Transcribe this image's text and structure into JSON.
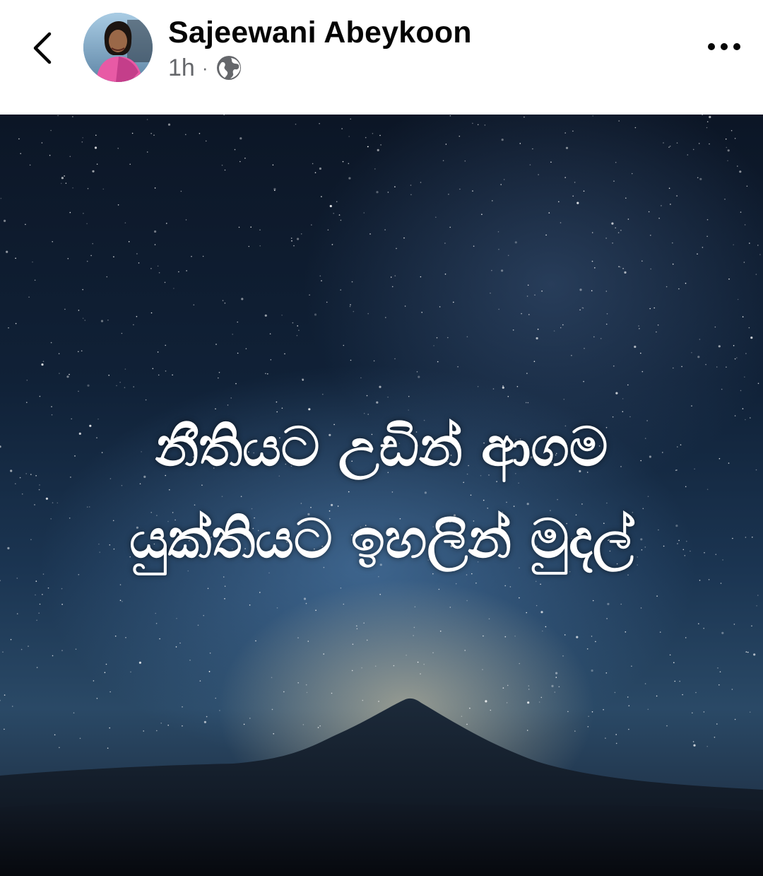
{
  "post": {
    "author_name": "Sajeewani Abeykoon",
    "timestamp": "1h",
    "separator": "·",
    "audience_icon": "globe-icon",
    "back_icon": "chevron-left-icon",
    "more_icon": "more-horizontal-icon"
  },
  "image": {
    "quote_line1": "නීතියට උඩින් ආගම",
    "quote_line2": "යුක්තියට ඉහලින් මුදල්",
    "scene": "starry-night-mountain"
  },
  "colors": {
    "name": "#050505",
    "meta": "#65676b",
    "sky_dark": "#0c1626",
    "glow": "#ebd7aa"
  }
}
